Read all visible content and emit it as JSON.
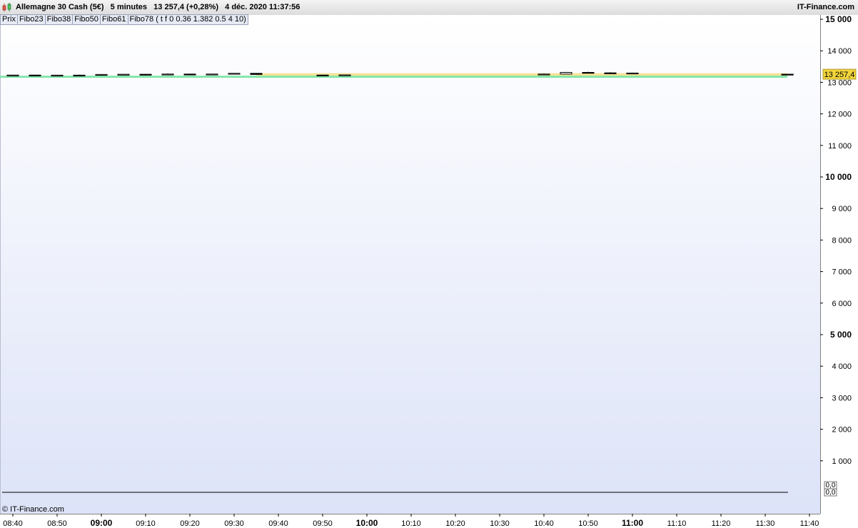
{
  "header": {
    "title": "Allemagne 30 Cash (5€)   5 minutes   13 257,4 (+0,28%)   4 déc. 2020 11:37:56",
    "brand": "IT-Finance.com"
  },
  "indicators": [
    "Prix",
    "Fibo23",
    "Fibo38",
    "Fibo50",
    "Fibo61",
    "Fibo78 ( t f 0 0.36 1.382 0.5 4 10)"
  ],
  "copyright": "© IT-Finance.com",
  "colors": {
    "fibo_upper": "#f5e08a",
    "fibo_lower": "#7de6a8",
    "price_tag": "#f2d53c",
    "candle": "#000000"
  },
  "chart_data": {
    "type": "candlestick",
    "y_ticks": [
      "1 000",
      "2 000",
      "3 000",
      "4 000",
      "5 000",
      "6 000",
      "7 000",
      "8 000",
      "9 000",
      "10 000",
      "11 000",
      "12 000",
      "13 000",
      "14 000",
      "15 000"
    ],
    "y_bold_ticks": [
      "5 000",
      "10 000",
      "15 000"
    ],
    "y_sub_ticks": [
      "0,0",
      "0,0"
    ],
    "ylim": [
      0,
      15000
    ],
    "x_ticks": [
      "08:40",
      "08:50",
      "09:00",
      "09:10",
      "09:20",
      "09:30",
      "09:40",
      "09:50",
      "10:00",
      "10:10",
      "10:20",
      "10:30",
      "10:40",
      "10:50",
      "11:00",
      "11:10",
      "11:20",
      "11:30",
      "11:40"
    ],
    "x_bold_ticks": [
      "09:00",
      "10:00",
      "11:00"
    ],
    "last_price_label": "13 257,4",
    "last_price": 13257.4,
    "fibo_band": {
      "start": "09:35",
      "end": "11:35",
      "upper": 13290,
      "lower": 13200
    },
    "candles": [
      {
        "t": "08:40",
        "o": 13225,
        "h": 13240,
        "l": 13215,
        "c": 13230
      },
      {
        "t": "08:45",
        "o": 13230,
        "h": 13238,
        "l": 13220,
        "c": 13225
      },
      {
        "t": "08:50",
        "o": 13225,
        "h": 13235,
        "l": 13218,
        "c": 13228
      },
      {
        "t": "08:55",
        "o": 13228,
        "h": 13240,
        "l": 13220,
        "c": 13224
      },
      {
        "t": "09:00",
        "o": 13224,
        "h": 13260,
        "l": 13215,
        "c": 13250
      },
      {
        "t": "09:05",
        "o": 13250,
        "h": 13262,
        "l": 13240,
        "c": 13255
      },
      {
        "t": "09:10",
        "o": 13255,
        "h": 13265,
        "l": 13245,
        "c": 13250
      },
      {
        "t": "09:15",
        "o": 13250,
        "h": 13280,
        "l": 13240,
        "c": 13262
      },
      {
        "t": "09:20",
        "o": 13262,
        "h": 13272,
        "l": 13250,
        "c": 13258
      },
      {
        "t": "09:25",
        "o": 13258,
        "h": 13268,
        "l": 13248,
        "c": 13262
      },
      {
        "t": "09:30",
        "o": 13262,
        "h": 13290,
        "l": 13255,
        "c": 13285
      },
      {
        "t": "09:35",
        "o": 13285,
        "h": 13292,
        "l": 13240,
        "c": 13250
      },
      {
        "t": "09:50",
        "o": 13230,
        "h": 13240,
        "l": 13210,
        "c": 13220
      },
      {
        "t": "09:55",
        "o": 13220,
        "h": 13245,
        "l": 13205,
        "c": 13235
      },
      {
        "t": "10:40",
        "o": 13258,
        "h": 13275,
        "l": 13250,
        "c": 13262
      },
      {
        "t": "10:45",
        "o": 13262,
        "h": 13330,
        "l": 13255,
        "c": 13315
      },
      {
        "t": "10:50",
        "o": 13315,
        "h": 13335,
        "l": 13280,
        "c": 13300
      },
      {
        "t": "10:55",
        "o": 13300,
        "h": 13320,
        "l": 13270,
        "c": 13285
      },
      {
        "t": "11:00",
        "o": 13285,
        "h": 13305,
        "l": 13262,
        "c": 13295
      },
      {
        "t": "11:35",
        "o": 13258,
        "h": 13262,
        "l": 13254,
        "c": 13257
      }
    ]
  }
}
